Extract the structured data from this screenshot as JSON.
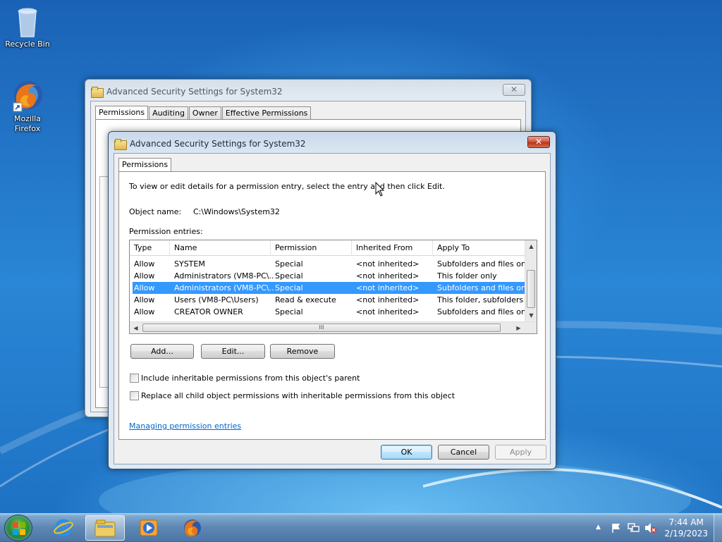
{
  "desktop": {
    "icons": [
      {
        "label": "Recycle Bin"
      },
      {
        "label_line1": "Mozilla",
        "label_line2": "Firefox"
      }
    ]
  },
  "back_window": {
    "title": "Advanced Security Settings for System32",
    "close_glyph": "✕",
    "tabs": [
      "Permissions",
      "Auditing",
      "Owner",
      "Effective Permissions"
    ]
  },
  "dialog": {
    "title": "Advanced Security Settings for System32",
    "close_glyph": "✕",
    "tab": "Permissions",
    "instructions": "To view or edit details for a permission entry, select the entry and then click Edit.",
    "object_name_label": "Object name:",
    "object_name_value": "C:\\Windows\\System32",
    "entries_label": "Permission entries:",
    "columns": [
      "Type",
      "Name",
      "Permission",
      "Inherited From",
      "Apply To"
    ],
    "rows": [
      {
        "type": "Allow",
        "name": "SYSTEM",
        "permission": "Special",
        "inherited": "<not inherited>",
        "apply": "Subfolders and files only"
      },
      {
        "type": "Allow",
        "name": "Administrators (VM8-PC\\...",
        "permission": "Special",
        "inherited": "<not inherited>",
        "apply": "This folder only"
      },
      {
        "type": "Allow",
        "name": "Administrators (VM8-PC\\...",
        "permission": "Special",
        "inherited": "<not inherited>",
        "apply": "Subfolders and files only"
      },
      {
        "type": "Allow",
        "name": "Users (VM8-PC\\Users)",
        "permission": "Read & execute",
        "inherited": "<not inherited>",
        "apply": "This folder, subfolders a..."
      },
      {
        "type": "Allow",
        "name": "CREATOR OWNER",
        "permission": "Special",
        "inherited": "<not inherited>",
        "apply": "Subfolders and files only"
      }
    ],
    "selected_row": 2,
    "scroll_grip": "III",
    "add_label": "Add...",
    "edit_label": "Edit...",
    "remove_label": "Remove",
    "include_inheritable": "Include inheritable permissions from this object's parent",
    "replace_child": "Replace all child object permissions with inheritable permissions from this object",
    "help_link": "Managing permission entries",
    "ok_label": "OK",
    "cancel_label": "Cancel",
    "apply_label": "Apply"
  },
  "taskbar": {
    "time": "7:44 AM",
    "date": "2/19/2023",
    "tray_overflow_glyph": "▲"
  }
}
